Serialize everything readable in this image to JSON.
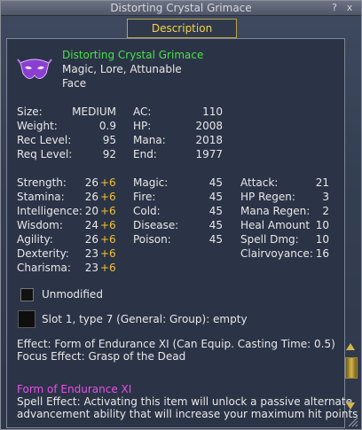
{
  "window": {
    "title": "Distorting Crystal Grimace",
    "help": "?",
    "close": "x"
  },
  "tab": {
    "label": "Description"
  },
  "item": {
    "name": "Distorting Crystal Grimace",
    "flags": "Magic, Lore, Attunable",
    "slot": "Face"
  },
  "basic": {
    "left": [
      {
        "label": "Size:",
        "value": "MEDIUM"
      },
      {
        "label": "Weight:",
        "value": "0.9"
      },
      {
        "label": "Rec Level:",
        "value": "95"
      },
      {
        "label": "Req Level:",
        "value": "92"
      }
    ],
    "right": [
      {
        "label": "AC:",
        "value": "110"
      },
      {
        "label": "HP:",
        "value": "2008"
      },
      {
        "label": "Mana:",
        "value": "2018"
      },
      {
        "label": "End:",
        "value": "1977"
      }
    ]
  },
  "stats": [
    {
      "label": "Strength:",
      "value": "26",
      "bonus": "+6"
    },
    {
      "label": "Stamina:",
      "value": "26",
      "bonus": "+6"
    },
    {
      "label": "Intelligence:",
      "value": "20",
      "bonus": "+6"
    },
    {
      "label": "Wisdom:",
      "value": "24",
      "bonus": "+6"
    },
    {
      "label": "Agility:",
      "value": "26",
      "bonus": "+6"
    },
    {
      "label": "Dexterity:",
      "value": "23",
      "bonus": "+6"
    },
    {
      "label": "Charisma:",
      "value": "23",
      "bonus": "+6"
    }
  ],
  "resists": [
    {
      "label": "Magic:",
      "value": "45"
    },
    {
      "label": "Fire:",
      "value": "45"
    },
    {
      "label": "Cold:",
      "value": "45"
    },
    {
      "label": "Disease:",
      "value": "45"
    },
    {
      "label": "Poison:",
      "value": "45"
    }
  ],
  "combat": [
    {
      "label": "Attack:",
      "value": "21"
    },
    {
      "label": "HP Regen:",
      "value": "3"
    },
    {
      "label": "Mana Regen:",
      "value": "2"
    },
    {
      "label": "Heal Amount",
      "value": "10"
    },
    {
      "label": "Spell Dmg:",
      "value": "10"
    },
    {
      "label": "Clairvoyance:",
      "value": "16"
    }
  ],
  "unmodified_label": "Unmodified",
  "slot_text": "Slot 1, type 7 (General: Group): empty",
  "effect": "Effect: Form of Endurance XI (Can Equip. Casting Time: 0.5)",
  "focus": "Focus Effect: Grasp of the Dead",
  "spell": {
    "name": "Form of Endurance XI",
    "line1": "Spell Effect: Activating this item will unlock a passive alternate",
    "line2": "advancement ability that will increase your maximum hit points by"
  },
  "colors": {
    "item_name": "#4be14b",
    "bonus": "#f2c230",
    "spell_name": "#e84ee8",
    "tab_text": "#f2d24a"
  }
}
